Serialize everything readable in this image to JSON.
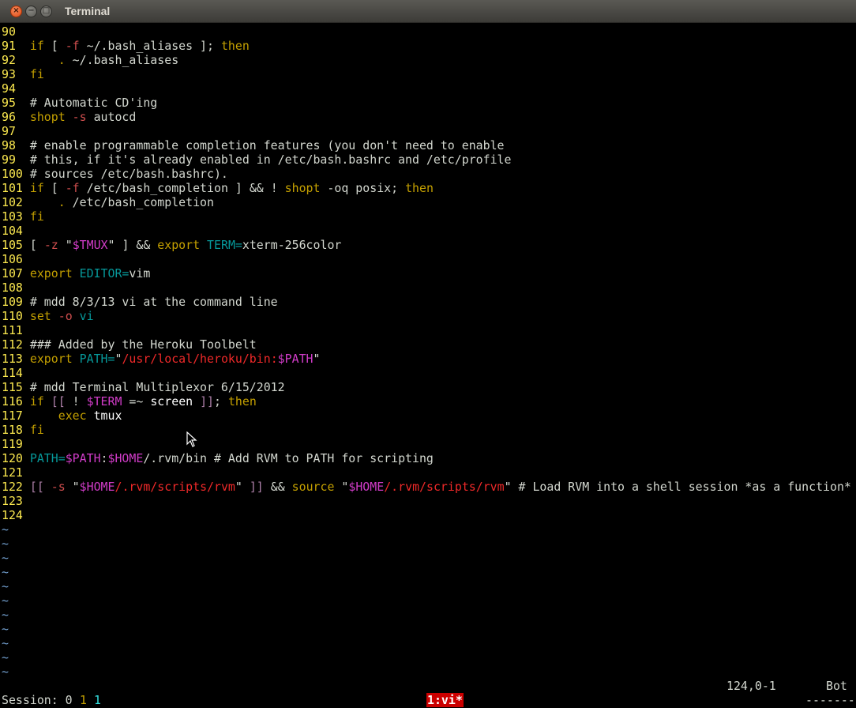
{
  "window": {
    "title": "Terminal"
  },
  "title_buttons": {
    "close": "×",
    "minimize": "−",
    "maximize": "□"
  },
  "editor": {
    "lines": [
      {
        "n": "90",
        "segs": []
      },
      {
        "n": "91",
        "segs": [
          [
            "kw",
            "if"
          ],
          [
            "cm",
            " [ "
          ],
          [
            "op",
            "-f"
          ],
          [
            "cm",
            " ~/.bash_aliases ]; "
          ],
          [
            "kw",
            "then"
          ]
        ]
      },
      {
        "n": "92",
        "segs": [
          [
            "cm",
            "    "
          ],
          [
            "kw",
            "."
          ],
          [
            "cm",
            " ~/.bash_aliases"
          ]
        ]
      },
      {
        "n": "93",
        "segs": [
          [
            "kw",
            "fi"
          ]
        ]
      },
      {
        "n": "94",
        "segs": []
      },
      {
        "n": "95",
        "segs": [
          [
            "cm",
            "# Automatic CD'ing"
          ]
        ]
      },
      {
        "n": "96",
        "segs": [
          [
            "kw",
            "shopt"
          ],
          [
            "cm",
            " "
          ],
          [
            "op",
            "-s"
          ],
          [
            "cm",
            " autocd"
          ]
        ]
      },
      {
        "n": "97",
        "segs": []
      },
      {
        "n": "98",
        "segs": [
          [
            "cm",
            "# enable programmable completion features (you don't need to enable"
          ]
        ]
      },
      {
        "n": "99",
        "segs": [
          [
            "cm",
            "# this, if it's already enabled in /etc/bash.bashrc and /etc/profile"
          ]
        ]
      },
      {
        "n": "100",
        "segs": [
          [
            "cm",
            "# sources /etc/bash.bashrc)."
          ]
        ]
      },
      {
        "n": "101",
        "segs": [
          [
            "kw",
            "if"
          ],
          [
            "cm",
            " [ "
          ],
          [
            "op",
            "-f"
          ],
          [
            "cm",
            " /etc/bash_completion ] && ! "
          ],
          [
            "kw",
            "shopt"
          ],
          [
            "cm",
            " -oq posix; "
          ],
          [
            "kw",
            "then"
          ]
        ]
      },
      {
        "n": "102",
        "segs": [
          [
            "cm",
            "    "
          ],
          [
            "kw",
            "."
          ],
          [
            "cm",
            " /etc/bash_completion"
          ]
        ]
      },
      {
        "n": "103",
        "segs": [
          [
            "kw",
            "fi"
          ]
        ]
      },
      {
        "n": "104",
        "segs": []
      },
      {
        "n": "105",
        "segs": [
          [
            "cm",
            "[ "
          ],
          [
            "op",
            "-z"
          ],
          [
            "cm",
            " \""
          ],
          [
            "vb",
            "$TMUX"
          ],
          [
            "cm",
            "\" ] && "
          ],
          [
            "kw",
            "export"
          ],
          [
            "cm",
            " "
          ],
          [
            "id",
            "TERM="
          ],
          [
            "cm",
            "xterm-256color"
          ]
        ]
      },
      {
        "n": "106",
        "segs": []
      },
      {
        "n": "107",
        "segs": [
          [
            "kw",
            "export"
          ],
          [
            "cm",
            " "
          ],
          [
            "id",
            "EDITOR="
          ],
          [
            "cm",
            "vim"
          ]
        ]
      },
      {
        "n": "108",
        "segs": []
      },
      {
        "n": "109",
        "segs": [
          [
            "cm",
            "# mdd 8/3/13 vi at the command line"
          ]
        ]
      },
      {
        "n": "110",
        "segs": [
          [
            "kw",
            "set"
          ],
          [
            "cm",
            " "
          ],
          [
            "op",
            "-o"
          ],
          [
            "cm",
            " "
          ],
          [
            "id",
            "vi"
          ]
        ]
      },
      {
        "n": "111",
        "segs": []
      },
      {
        "n": "112",
        "segs": [
          [
            "cm",
            "### Added by the Heroku Toolbelt"
          ]
        ]
      },
      {
        "n": "113",
        "segs": [
          [
            "kw",
            "export"
          ],
          [
            "cm",
            " "
          ],
          [
            "id",
            "PATH="
          ],
          [
            "cm",
            "\""
          ],
          [
            "st",
            "/usr/local/heroku/bin:"
          ],
          [
            "vb",
            "$PATH"
          ],
          [
            "cm",
            "\""
          ]
        ]
      },
      {
        "n": "114",
        "segs": []
      },
      {
        "n": "115",
        "segs": [
          [
            "cm",
            "# mdd Terminal Multiplexor 6/15/2012"
          ]
        ]
      },
      {
        "n": "116",
        "segs": [
          [
            "kw",
            "if"
          ],
          [
            "cm",
            " "
          ],
          [
            "va",
            "[["
          ],
          [
            "cm",
            " ! "
          ],
          [
            "vb",
            "$TERM"
          ],
          [
            "cm",
            " =~ "
          ],
          [
            "wt",
            "screen"
          ],
          [
            "cm",
            " "
          ],
          [
            "va",
            "]]"
          ],
          [
            "cm",
            "; "
          ],
          [
            "kw",
            "then"
          ]
        ]
      },
      {
        "n": "117",
        "segs": [
          [
            "cm",
            "    "
          ],
          [
            "kw",
            "exec"
          ],
          [
            "cm",
            " "
          ],
          [
            "wt",
            "tmux"
          ]
        ]
      },
      {
        "n": "118",
        "segs": [
          [
            "kw",
            "fi"
          ]
        ]
      },
      {
        "n": "119",
        "segs": []
      },
      {
        "n": "120",
        "segs": [
          [
            "id",
            "PATH="
          ],
          [
            "vb",
            "$PATH"
          ],
          [
            "cm",
            ":"
          ],
          [
            "vb",
            "$HOME"
          ],
          [
            "cm",
            "/.rvm/bin # Add RVM to PATH for scripting"
          ]
        ]
      },
      {
        "n": "121",
        "segs": []
      },
      {
        "n": "122",
        "segs": [
          [
            "va",
            "[["
          ],
          [
            "cm",
            " "
          ],
          [
            "op",
            "-s"
          ],
          [
            "cm",
            " \""
          ],
          [
            "vb",
            "$HOME"
          ],
          [
            "st",
            "/.rvm/scripts/rvm"
          ],
          [
            "cm",
            "\" "
          ],
          [
            "va",
            "]]"
          ],
          [
            "cm",
            " && "
          ],
          [
            "kw",
            "source"
          ],
          [
            "cm",
            " \""
          ],
          [
            "vb",
            "$HOME"
          ],
          [
            "st",
            "/.rvm/scripts/rvm"
          ],
          [
            "cm",
            "\" # Load RVM into a shell session *as a function*"
          ]
        ]
      },
      {
        "n": "123",
        "segs": []
      },
      {
        "n": "124",
        "segs": []
      }
    ],
    "tilde": "~",
    "tilde_count": 11
  },
  "vim_ruler": {
    "position": "124,0-1",
    "scroll": "Bot"
  },
  "tmux": {
    "session_label": "Session: 0",
    "session_num_a": "1",
    "session_num_b": "1",
    "window_active": "1:vi*",
    "right_fill": "-------"
  },
  "colors": {
    "title_text": "#dfdbd2",
    "line_number": "#fce94f",
    "keyword": "#c4a000",
    "string": "#ef2929",
    "variable": "#d13cc8",
    "identifier": "#06989a",
    "tilde": "#729fcf",
    "tmux_active": "#cc0000"
  }
}
